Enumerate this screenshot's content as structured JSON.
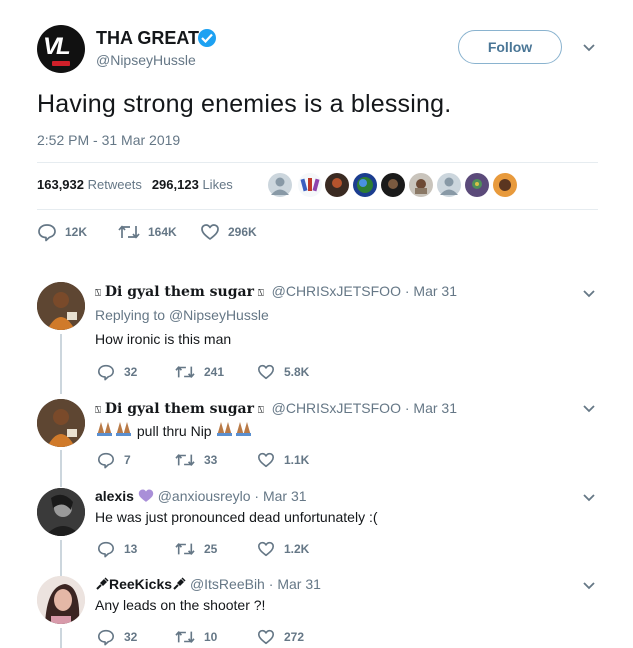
{
  "main_tweet": {
    "display_name": "THA GREAT",
    "handle": "@NipseyHussle",
    "follow_label": "Follow",
    "text": "Having strong enemies is a blessing.",
    "timestamp": "2:52 PM - 31 Mar 2019",
    "retweets_count": "163,932",
    "retweets_label": "Retweets",
    "likes_count": "296,123",
    "likes_label": "Likes",
    "reply_count": "12K",
    "retweet_action_count": "164K",
    "like_action_count": "296K",
    "verified_color": "#1da1f2"
  },
  "replies": [
    {
      "display_name": "Di gyal them sugar",
      "handle": "@CHRISxJETSFOO",
      "date": "Mar 31",
      "replying_to_label": "Replying to",
      "replying_to_handle": "@NipseyHussle",
      "text": "How ironic is this man",
      "replies": "32",
      "retweets": "241",
      "likes": "5.8K"
    },
    {
      "display_name": "Di gyal them sugar",
      "handle": "@CHRISxJETSFOO",
      "date": "Mar 31",
      "text": "pull thru Nip",
      "replies": "7",
      "retweets": "33",
      "likes": "1.1K"
    },
    {
      "display_name": "alexis",
      "handle": "@anxiousreylo",
      "date": "Mar 31",
      "text": "He was just pronounced dead unfortunately :(",
      "replies": "13",
      "retweets": "25",
      "likes": "1.2K"
    },
    {
      "display_name": "ReeKicks",
      "handle": "@ItsReeBih",
      "date": "Mar 31",
      "text": "Any leads on the shooter ?!",
      "replies": "32",
      "retweets": "10",
      "likes": "272"
    }
  ],
  "separator": "·",
  "icons": {
    "reply": "reply-icon",
    "retweet": "retweet-icon",
    "like": "heart-icon",
    "more": "chevron-down-icon",
    "verified": "verified-badge-icon"
  }
}
